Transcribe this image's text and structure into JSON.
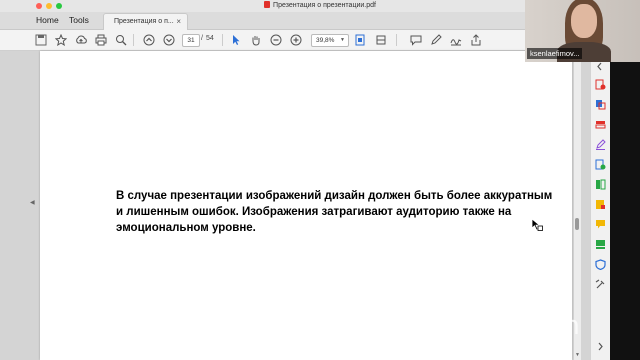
{
  "window": {
    "title": "Презентация о презентации.pdf"
  },
  "tabs": {
    "home": "Home",
    "tools": "Tools",
    "document": "Презентация о п...",
    "close": "×"
  },
  "toolbar": {
    "current_page": "31",
    "separator": "/",
    "total_pages": "54",
    "zoom_value": "39,8%"
  },
  "document": {
    "text": "В случае презентации изображений дизайн должен быть более аккуратным и лишенным ошибок. Изображения затрагивают аудиторию также на эмоциональном уровне."
  },
  "zoom_meeting": {
    "participant_name": "ksenlaefimov...",
    "watermark": "zoom"
  },
  "colors": {
    "titlebar": "#e6e6e6",
    "toolbar": "#f3f3f3",
    "page": "#ffffff",
    "canvas": "#d4d4d4",
    "pdf_red": "#e0302a",
    "tool_blue": "#2c6fd6"
  },
  "icons": {
    "toolbar": [
      "save-icon",
      "star-icon",
      "upload-icon",
      "print-icon",
      "zoom-search-icon",
      "page-up-icon",
      "page-down-icon",
      "select-cursor-icon",
      "hand-icon",
      "zoom-out-icon",
      "zoom-in-icon",
      "fit-page-icon",
      "scroll-mode-icon",
      "comment-icon",
      "pen-icon",
      "sign-icon",
      "share-icon"
    ],
    "right_panel": [
      "export-pdf-icon",
      "create-pdf-icon",
      "edit-pdf-icon",
      "fill-sign-icon",
      "organize-pages-icon",
      "combine-files-icon",
      "compress-icon",
      "comment-panel-icon",
      "stamp-icon",
      "protect-icon",
      "more-tools-icon"
    ]
  }
}
